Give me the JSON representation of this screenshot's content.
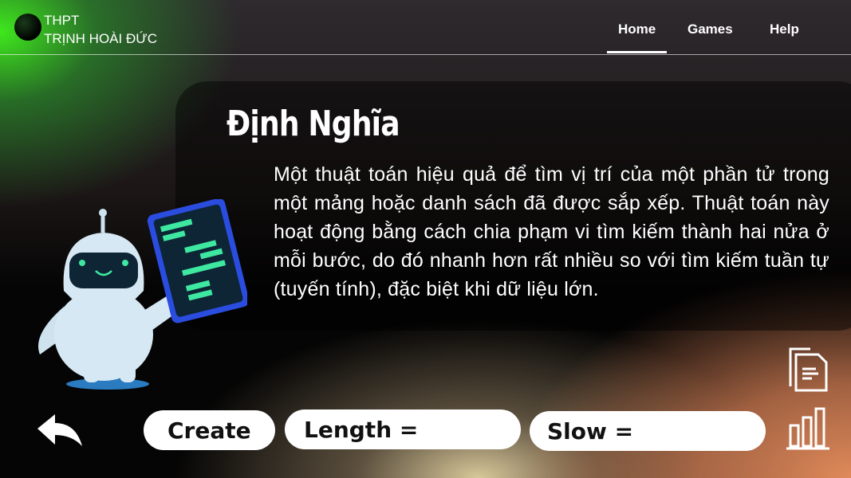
{
  "header": {
    "logo_line1": "THPT",
    "logo_line2": "TRỊNH HOÀI ĐỨC",
    "nav": [
      {
        "label": "Home",
        "active": true
      },
      {
        "label": "Games"
      },
      {
        "label": "Help"
      }
    ]
  },
  "main": {
    "title": "Định Nghĩa",
    "paragraph": "Một thuật toán hiệu quả để tìm vị trí của một phần tử trong một mảng hoặc danh sách đã được sắp xếp. Thuật toán này hoạt động bằng cách chia phạm vi tìm kiếm thành hai nửa ở mỗi bước, do đó nhanh hơn rất nhiều so với tìm kiếm tuần tự (tuyến tính), đặc biệt khi dữ liệu lớn."
  },
  "controls": {
    "create_label": "Create",
    "length_label": "Length =",
    "length_value": "",
    "slow_label": "Slow =",
    "slow_value": ""
  },
  "colors": {
    "accent_green": "#3fe81d",
    "tablet_blue": "#2a4de0",
    "screen_green": "#3ee8a0"
  }
}
